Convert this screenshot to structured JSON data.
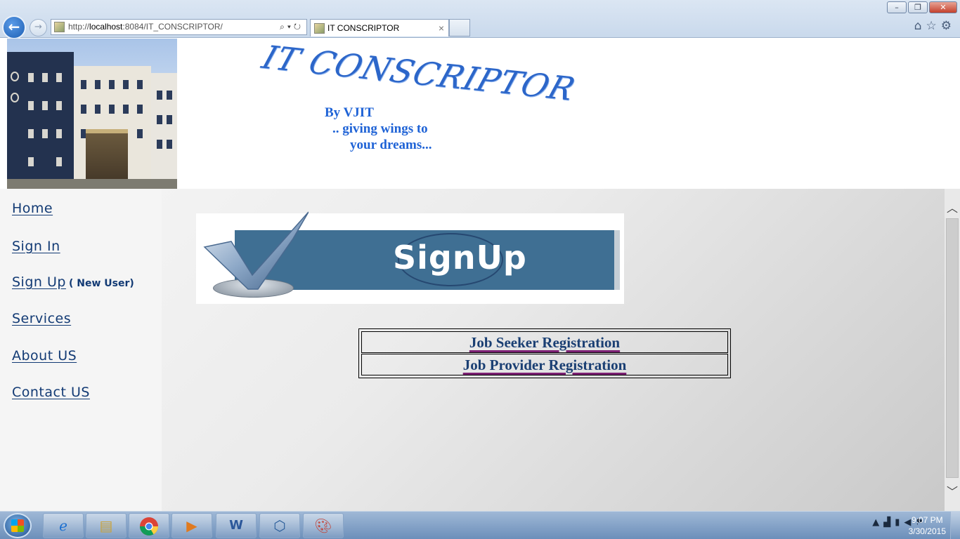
{
  "browser": {
    "url_prefix": "http://",
    "url_host": "localhost",
    "url_rest": ":8084/IT_CONSCRIPTOR/",
    "tab_title": "IT CONSCRIPTOR",
    "back_icon": "back-arrow-icon",
    "forward_icon": "forward-arrow-icon",
    "window_buttons": [
      "minimize",
      "restore",
      "close"
    ]
  },
  "header": {
    "logo_text": "IT CONSCRIPTOR",
    "tagline_1": "By VJIT",
    "tagline_2": ".. giving wings to",
    "tagline_3": "your dreams..."
  },
  "sidebar": {
    "items": [
      {
        "label": "Home"
      },
      {
        "label": "Sign In"
      },
      {
        "label": "Sign Up",
        "sub": "( New User)"
      },
      {
        "label": "Services"
      },
      {
        "label": "About US"
      },
      {
        "label": "Contact US"
      }
    ]
  },
  "main": {
    "banner_text": "SignUp",
    "registration_links": [
      "Job Seeker Registration",
      "Job Provider Registration"
    ]
  },
  "taskbar": {
    "time": "9:07 PM",
    "date": "3/30/2015",
    "apps": [
      "internet-explorer",
      "file-explorer",
      "chrome",
      "media-player",
      "word",
      "virtualbox",
      "paint"
    ]
  },
  "colors": {
    "link": "#123a74",
    "tagline": "#1f63d6",
    "banner_band": "#3f6f93"
  }
}
